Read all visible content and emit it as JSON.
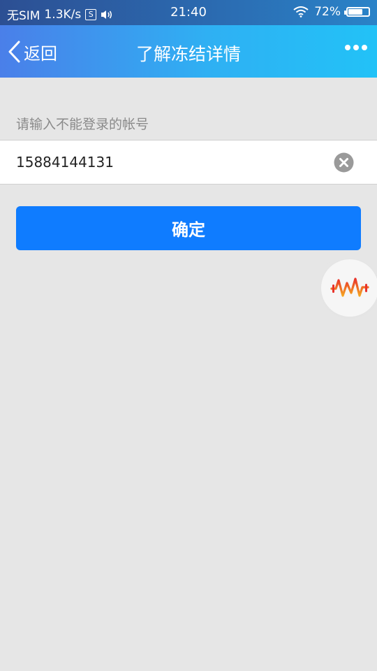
{
  "status_bar": {
    "carrier": "无SIM",
    "speed": "1.3K/s",
    "sim_icon_text": "S",
    "time": "21:40",
    "battery": "72%",
    "battery_level": 0.72
  },
  "nav": {
    "back_label": "返回",
    "title": "了解冻结详情"
  },
  "form": {
    "prompt": "请输入不能登录的帐号",
    "account_value": "15884144131",
    "confirm_label": "确定"
  },
  "icons": {
    "back": "chevron-left-icon",
    "more": "more-dots-icon",
    "clear": "clear-circle-icon",
    "float": "voice-wave-icon"
  },
  "colors": {
    "status_bar": "#2b6ab0",
    "nav_start": "#4a7fe9",
    "nav_end": "#22c2f7",
    "button": "#0f7cff",
    "background": "#e6e6e6",
    "float_icon": "#f04a2a"
  }
}
